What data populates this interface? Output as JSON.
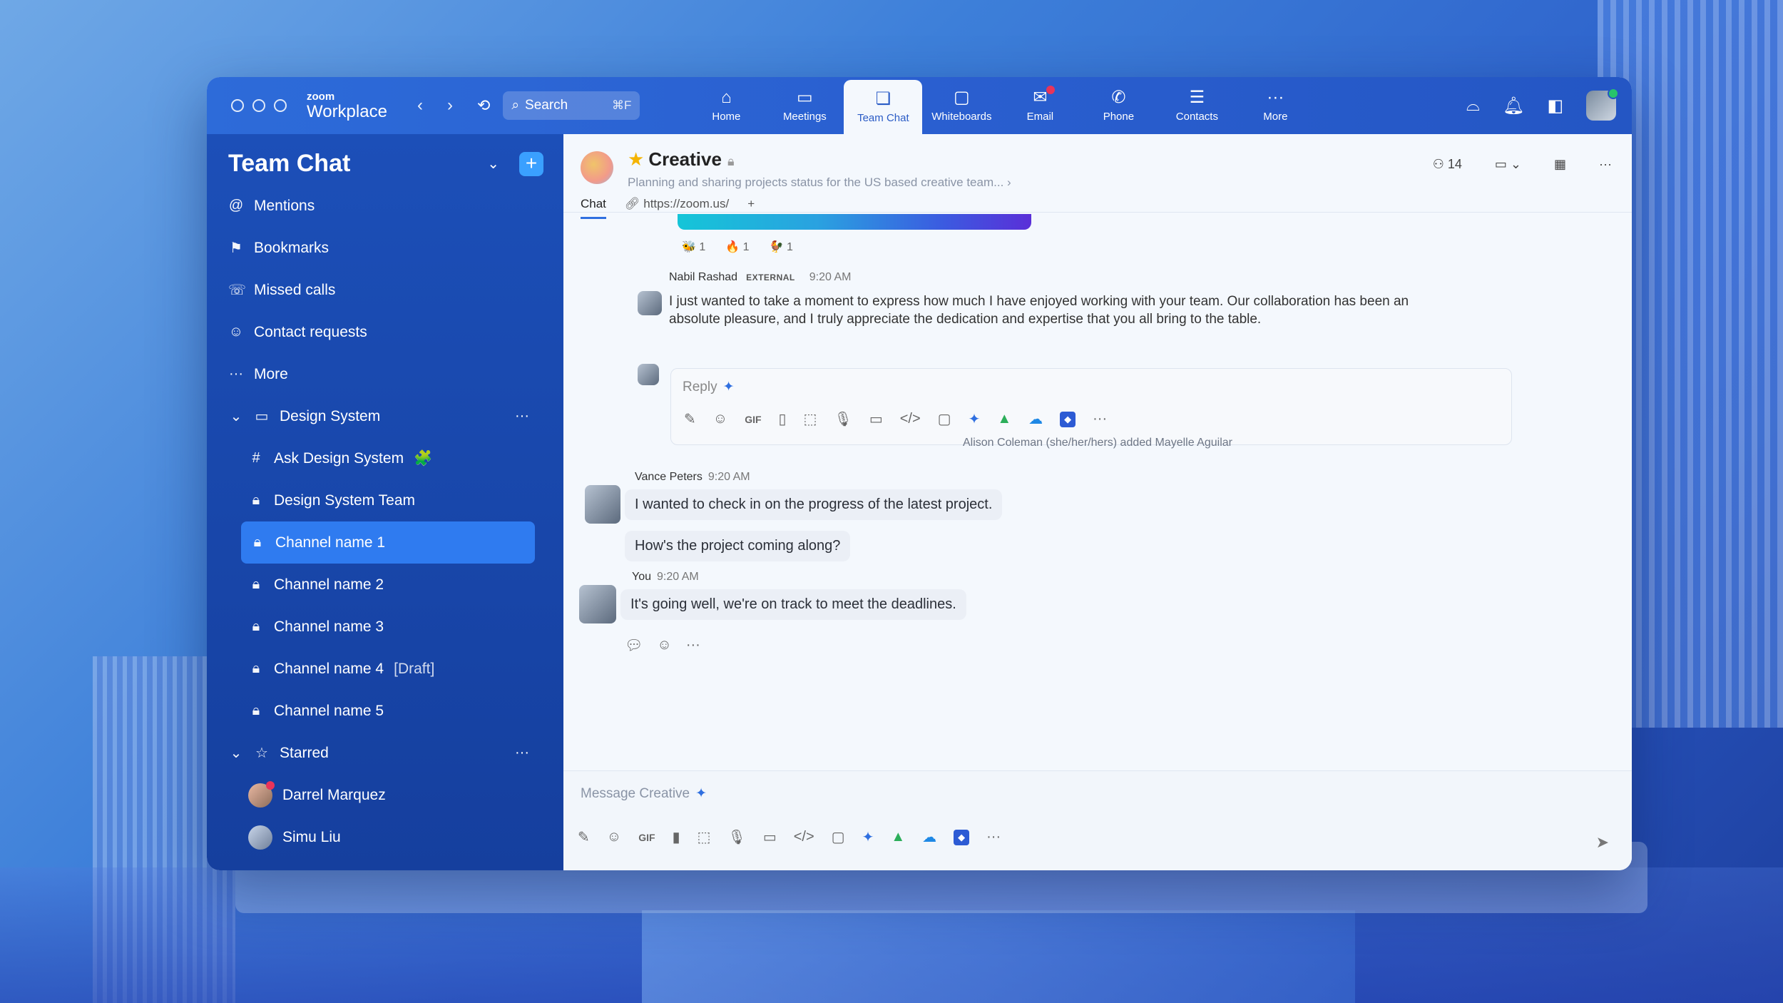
{
  "app": {
    "brand_small": "zoom",
    "brand": "Workplace"
  },
  "search": {
    "label": "Search",
    "shortcut": "⌘F"
  },
  "nav_tabs": [
    {
      "label": "Home",
      "icon": "home-icon",
      "glyph": "⌂"
    },
    {
      "label": "Meetings",
      "icon": "video-icon",
      "glyph": "▭"
    },
    {
      "label": "Team Chat",
      "icon": "chat-icon",
      "glyph": "❏"
    },
    {
      "label": "Whiteboards",
      "icon": "whiteboard-icon",
      "glyph": "▢"
    },
    {
      "label": "Email",
      "icon": "mail-icon",
      "glyph": "✉"
    },
    {
      "label": "Phone",
      "icon": "phone-icon",
      "glyph": "✆"
    },
    {
      "label": "Contacts",
      "icon": "contacts-icon",
      "glyph": "☰"
    },
    {
      "label": "More",
      "icon": "more-icon",
      "glyph": "···"
    }
  ],
  "sidebar": {
    "title": "Team Chat",
    "quick": [
      {
        "label": "Mentions",
        "glyph": "@"
      },
      {
        "label": "Bookmarks",
        "glyph": "⚑"
      },
      {
        "label": "Missed calls",
        "glyph": "☏"
      },
      {
        "label": "Contact requests",
        "glyph": "☺"
      },
      {
        "label": "More",
        "glyph": "···"
      }
    ],
    "folder": "Design System",
    "folder_channels": [
      {
        "label": "Ask Design System",
        "glyph": "#",
        "suffix": "🧩"
      },
      {
        "label": "Design System Team",
        "glyph": "🔒"
      }
    ],
    "channels": [
      {
        "label": "Channel name 1",
        "active": true
      },
      {
        "label": "Channel name 2"
      },
      {
        "label": "Channel name 3"
      },
      {
        "label": "Channel name 4",
        "draft": "[Draft]"
      },
      {
        "label": "Channel name 5"
      }
    ],
    "starred": "Starred",
    "contacts": [
      "Darrel Marquez",
      "Simu Liu"
    ]
  },
  "channel": {
    "name": "Creative",
    "description": "Planning and sharing projects status for the US based creative team... ›",
    "members": "14",
    "tabs": [
      "Chat",
      "https://zoom.us/"
    ]
  },
  "reactions": [
    {
      "emoji": "🐝",
      "count": "1"
    },
    {
      "emoji": "🔥",
      "count": "1"
    },
    {
      "emoji": "🐓",
      "count": "1"
    }
  ],
  "messages": {
    "nabil": {
      "name": "Nabil Rashad",
      "tag": "EXTERNAL",
      "time": "9:20 AM",
      "line1": "I just wanted to take a moment to express how much I have enjoyed working with your team. Our collaboration has been an",
      "line2": "absolute pleasure, and I truly appreciate the dedication and expertise that you all bring to the table."
    },
    "reply_placeholder": "Reply",
    "system": "Alison Coleman (she/her/hers) added Mayelle Aguilar",
    "vance": {
      "name": "Vance Peters",
      "time": "9:20 AM",
      "text1": "I wanted to check in on the progress of the latest project.",
      "text2": "How's the project coming along?"
    },
    "you": {
      "name": "You",
      "time": "9:20 AM",
      "text": "It's going well, we're on track to meet the deadlines."
    }
  },
  "compose": {
    "placeholder": "Message Creative"
  },
  "toolbar_gif": "GIF",
  "colors": {
    "accent": "#2f6fe0",
    "sidebar": "#1c4fb8",
    "active_item": "#2f7bf0"
  }
}
